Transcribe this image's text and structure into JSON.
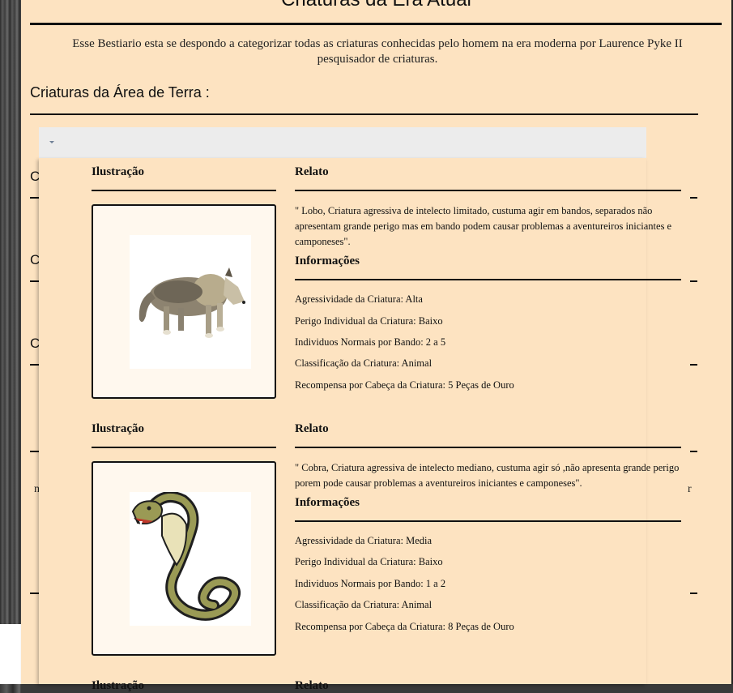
{
  "page": {
    "title": "Criaturas da Era Atual",
    "intro": "Esse Bestiario esta se despondo a categorizar todas as criaturas conhecidas pelo homem na era moderna por Laurence Pyke II pesquisador de criaturas.",
    "section_heading": "Criaturas da Área de Terra :"
  },
  "background_list": {
    "initials": [
      "C",
      "C",
      "C"
    ],
    "right_fragment": "r",
    "left_fragment": "n"
  },
  "creatures": [
    {
      "illus_label": "Ilustração",
      "relato_label": "Relato",
      "relato": "\" Lobo, Criatura agressiva de intelecto limitado, custuma agir em bandos, separados não apresentam grande perigo mas em bando podem causar problemas a aventureiros iniciantes e camponeses\".",
      "info_label": "Informações",
      "info": [
        "Agressividade da Criatura: Alta",
        "Perigo Individual da Criatura: Baixo",
        "Individuos Normais por Bando: 2 a 5",
        "Classificação da Criatura: Animal",
        "Recompensa por Cabeça da Criatura: 5 Peças de Ouro"
      ],
      "icon": "wolf-illustration"
    },
    {
      "illus_label": "Ilustração",
      "relato_label": "Relato",
      "relato": "\" Cobra, Criatura agressiva de intelecto mediano, custuma agir só ,não apresenta grande perigo porem pode causar problemas a aventureiros iniciantes e camponeses\".",
      "info_label": "Informações",
      "info": [
        "Agressividade da Criatura: Media",
        "Perigo Individual da Criatura: Baixo",
        "Individuos Normais por Bando: 1 a 2",
        "Classificação da Criatura: Animal",
        "Recompensa por Cabeça da Criatura: 8 Peças de Ouro"
      ],
      "icon": "cobra-illustration"
    },
    {
      "illus_label": "Ilustração",
      "relato_label": "Relato"
    }
  ],
  "colors": {
    "page_bg": "#fde3c1",
    "dropdown_bg": "#ececec",
    "rule": "#111111"
  }
}
